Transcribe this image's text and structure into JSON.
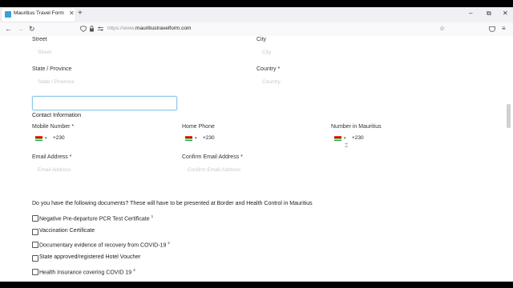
{
  "browser": {
    "tab_title": "Mauritius Travel Form",
    "tab_close": "✕",
    "new_tab": "+",
    "url_prefix": "https://www.",
    "url_domain": "mauritiustravelform.com",
    "window_controls": [
      "–",
      "⧉",
      "✕"
    ]
  },
  "address": {
    "street_label": "Street",
    "street_placeholder": "Street",
    "city_label": "City",
    "city_placeholder": "City",
    "state_label": "State / Province",
    "state_placeholder": "State / Province",
    "country_label": "Country *",
    "country_placeholder": "Country"
  },
  "contact": {
    "heading": "Contact Information",
    "mobile_label": "Mobile Number *",
    "mobile_value": "+230",
    "home_label": "Home Phone",
    "home_value": "+230",
    "mauritius_label": "Number in Mauritius",
    "mauritius_value": "+230",
    "email_label": "Email Address *",
    "email_placeholder": "Email Address",
    "confirm_label": "Confirm Email Address *",
    "confirm_placeholder": "Confirm Email Address",
    "flag_colors": [
      "#ea2839",
      "#1a206d",
      "#ffd500",
      "#00a551"
    ]
  },
  "documents": {
    "question": "Do you have the following documents? These will have to be presented at Border and Health Control in Mauritius",
    "items": [
      {
        "label": "Negative Pre-departure PCR Test Certificate",
        "sup": "1"
      },
      {
        "label": "Vaccination Certificate",
        "sup": ""
      },
      {
        "label": "Documentary evidence of recovery from COVID-19",
        "sup": "2"
      },
      {
        "label": "State approved/registered Hotel Voucher",
        "sup": ""
      },
      {
        "label": "Health Insurance covering COVID 19",
        "sup": "3"
      }
    ]
  }
}
